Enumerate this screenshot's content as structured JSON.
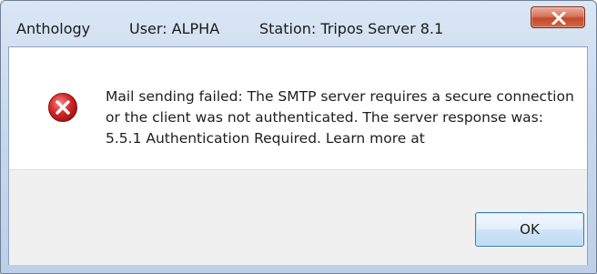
{
  "window": {
    "title": {
      "app": "Anthology",
      "user": "User: ALPHA",
      "station": "Station: Tripos Server 8.1"
    },
    "close_icon": "close-icon"
  },
  "dialog": {
    "icon": "error-icon",
    "message": "Mail sending failed: The SMTP server requires a secure connection or the client was not authenticated. The server response was: 5.5.1 Authentication Required. Learn more at",
    "ok_label": "OK"
  },
  "colors": {
    "close_button": "#c44a2c",
    "error_icon": "#c81e1e",
    "ok_border": "#3c7fb1"
  }
}
